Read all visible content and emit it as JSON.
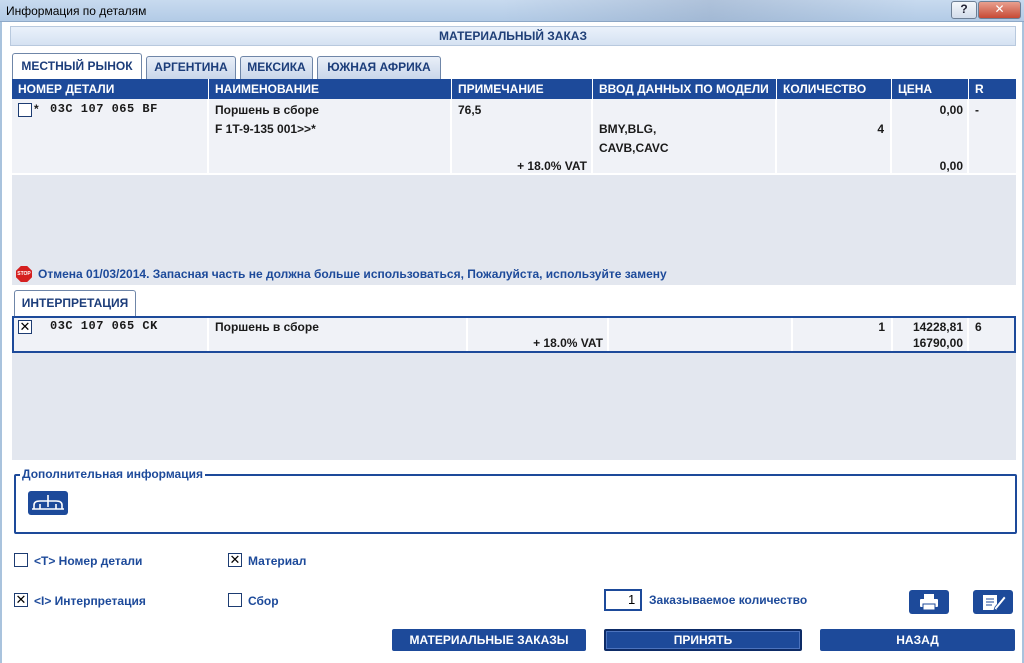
{
  "window": {
    "title": "Информация по деталям",
    "help_label": "?",
    "close_label": "✕"
  },
  "header": {
    "title": "МАТЕРИАЛЬНЫЙ ЗАКАЗ"
  },
  "market_tabs": [
    {
      "label": "МЕСТНЫЙ РЫНОК",
      "active": true
    },
    {
      "label": "АРГЕНТИНА",
      "active": false
    },
    {
      "label": "МЕКСИКА",
      "active": false
    },
    {
      "label": "ЮЖНАЯ АФРИКА",
      "active": false
    }
  ],
  "columns": [
    "НОМЕР ДЕТАЛИ",
    "НАИМЕНОВАНИЕ",
    "ПРИМЕЧАНИЕ",
    "ВВОД ДАННЫХ ПО МОДЕЛИ",
    "КОЛИЧЕСТВО",
    "ЦЕНА",
    "R"
  ],
  "part_row": {
    "checked": false,
    "marker": "*",
    "part_number": "03C 107 065 BF",
    "name_line1": "Поршень в сборе",
    "name_line2": "F 1T-9-135 001>>*",
    "note": "76,5",
    "vat": "+ 18.0% VAT",
    "model_line1": "BMY,BLG,",
    "model_line2": "CAVB,CAVC",
    "quantity": "4",
    "price": "0,00",
    "price_vat": "0,00",
    "r": "-"
  },
  "warning": {
    "icon_text": "STOP",
    "text": "Отмена 01/03/2014. Запасная часть не должна больше использоваться, Пожалуйста, используйте замену"
  },
  "interpretation": {
    "tab_label": "ИНТЕРПРЕТАЦИЯ",
    "row": {
      "checked": true,
      "check_mark": "✕",
      "part_number": "03C 107 065 CK",
      "name": "Поршень в сборе",
      "vat": "+ 18.0% VAT",
      "quantity": "1",
      "price": "14228,81",
      "price_vat": "16790,00",
      "r": "6"
    }
  },
  "additional_info": {
    "label": "Дополнительная информация"
  },
  "options": {
    "part_number": {
      "label": "<T> Номер детали",
      "checked": false
    },
    "material": {
      "label": "Материал",
      "checked": true,
      "mark": "✕"
    },
    "interpretation": {
      "label": "<I> Интерпретация",
      "checked": true,
      "mark": "✕"
    },
    "assembly": {
      "label": "Сбор",
      "checked": false
    }
  },
  "order_quantity": {
    "value": "1",
    "label": "Заказываемое количество"
  },
  "buttons": {
    "material_orders": "МАТЕРИАЛЬНЫЕ ЗАКАЗЫ",
    "accept": "ПРИНЯТЬ",
    "back": "НАЗАД"
  },
  "colors": {
    "accent": "#1d4a9a",
    "row_bg": "#f0f2f7",
    "empty_bg": "#e3e7ef",
    "stop_red": "#d52020"
  }
}
